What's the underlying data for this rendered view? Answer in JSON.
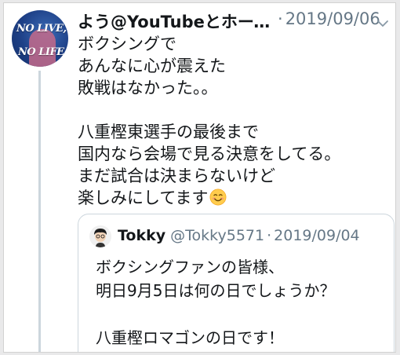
{
  "tweet": {
    "author": "よう@YouTubeとホーム…",
    "separator": "·",
    "date": "2019/09/06",
    "avatar_text": {
      "line1": "NO LIVE,",
      "line2": "NO LIFE."
    },
    "lines": [
      "ボクシングで",
      "あんなに心が震えた",
      "敗戦はなかった。。",
      "",
      "八重樫東選手の最後まで",
      "国内なら会場で見る決意をしてる。",
      "まだ試合は決まらないけど",
      "楽しみにしてます"
    ],
    "emoji": "smiling-face-icon"
  },
  "quoted_tweet": {
    "author": "Tokky",
    "handle": "@Tokky5571",
    "separator": "·",
    "date": "2019/09/04",
    "lines": [
      "ボクシングファンの皆様、",
      "明日9月5日は何の日でしょうか？",
      "",
      "八重樫ロマゴンの日です！"
    ]
  },
  "colors": {
    "text": "#14171a",
    "muted": "#657786",
    "border": "#ccd6dd"
  }
}
